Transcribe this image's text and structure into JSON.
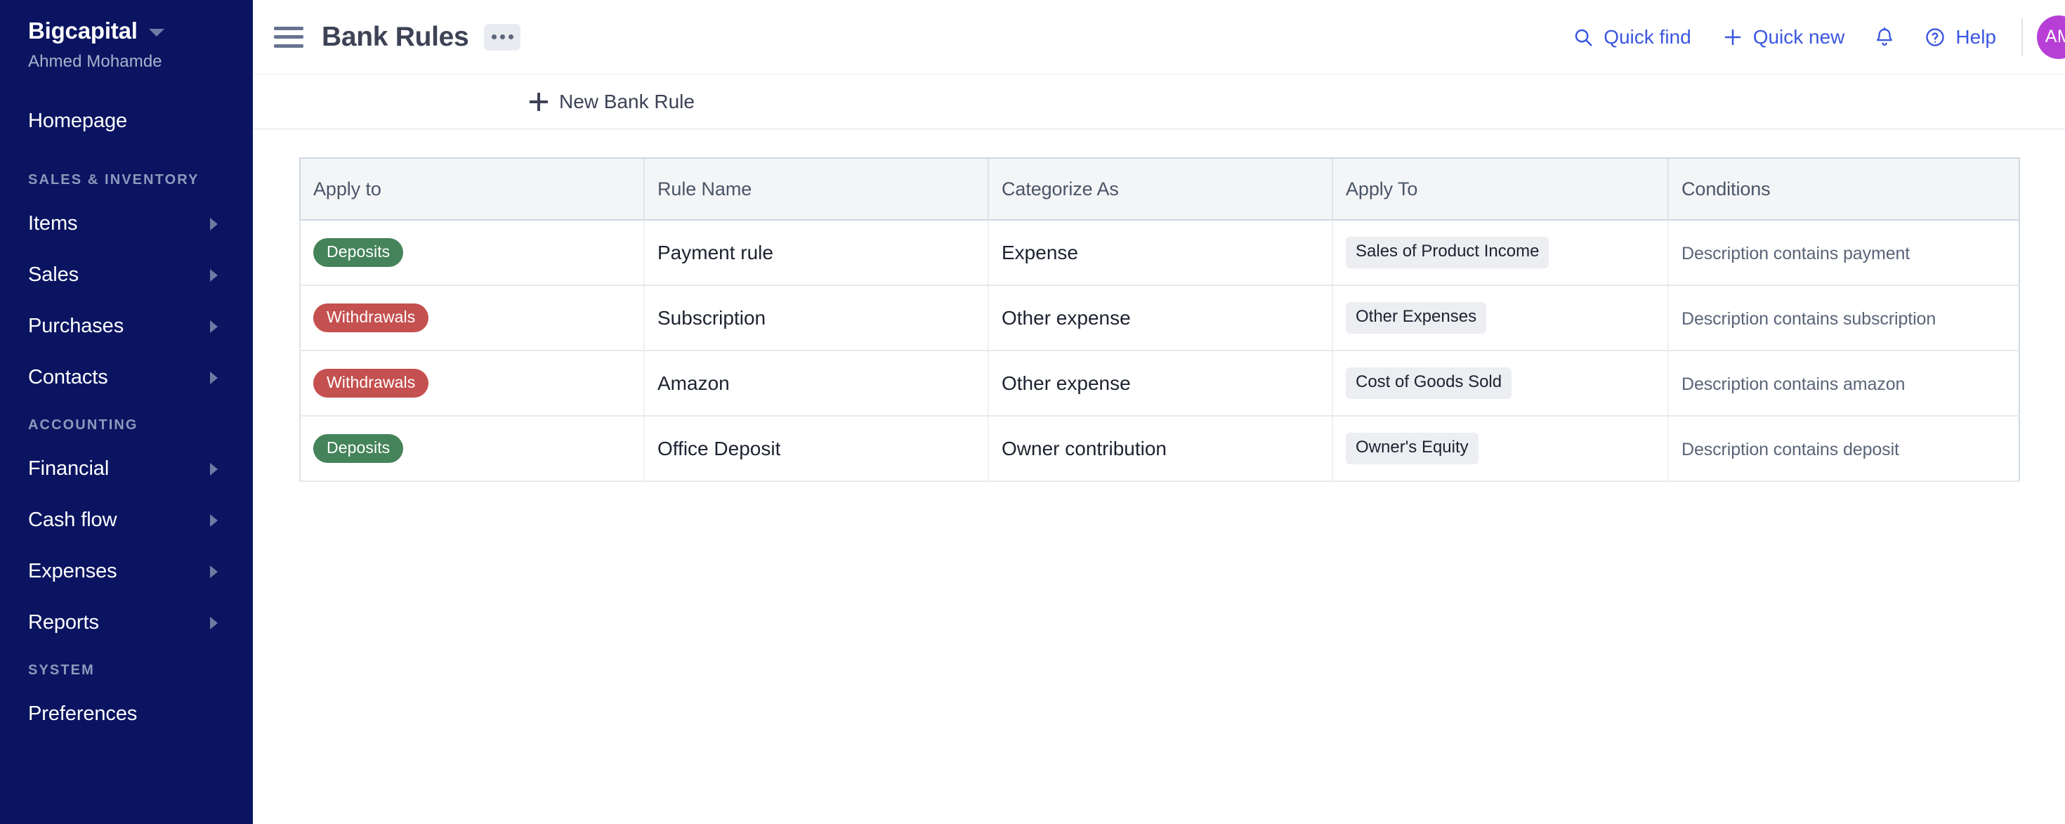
{
  "sidebar": {
    "brand": "Bigcapital",
    "user": "Ahmed Mohamde",
    "caret_icon": "chevron-down-icon",
    "items_top": [
      {
        "label": "Homepage",
        "has_chevron": false
      }
    ],
    "sections": [
      {
        "label": "SALES & INVENTORY",
        "items": [
          {
            "label": "Items",
            "has_chevron": true
          },
          {
            "label": "Sales",
            "has_chevron": true
          },
          {
            "label": "Purchases",
            "has_chevron": true
          },
          {
            "label": "Contacts",
            "has_chevron": true
          }
        ]
      },
      {
        "label": "ACCOUNTING",
        "items": [
          {
            "label": "Financial",
            "has_chevron": true
          },
          {
            "label": "Cash flow",
            "has_chevron": true
          },
          {
            "label": "Expenses",
            "has_chevron": true
          },
          {
            "label": "Reports",
            "has_chevron": true
          }
        ]
      },
      {
        "label": "SYSTEM",
        "items": [
          {
            "label": "Preferences",
            "has_chevron": false
          }
        ]
      }
    ]
  },
  "topbar": {
    "menu_icon": "hamburger-menu-icon",
    "title": "Bank Rules",
    "more_icon": "ellipsis-icon",
    "quick_find": "Quick find",
    "quick_find_icon": "search-icon",
    "quick_new": "Quick new",
    "quick_new_icon": "plus-icon",
    "notifications_icon": "bell-icon",
    "help": "Help",
    "help_icon": "question-circle-icon",
    "avatar_initials": "AM"
  },
  "subbar": {
    "new_rule_label": "New Bank Rule",
    "new_rule_icon": "plus-icon"
  },
  "table": {
    "columns": [
      "Apply to",
      "Rule Name",
      "Categorize As",
      "Apply To",
      "Conditions"
    ],
    "rows": [
      {
        "apply_to": "Deposits",
        "apply_to_type": "deposits",
        "rule_name": "Payment rule",
        "categorize_as": "Expense",
        "account": "Sales of Product Income",
        "conditions": "Description contains payment"
      },
      {
        "apply_to": "Withdrawals",
        "apply_to_type": "withdrawals",
        "rule_name": "Subscription",
        "categorize_as": "Other expense",
        "account": "Other Expenses",
        "conditions": "Description contains subscription"
      },
      {
        "apply_to": "Withdrawals",
        "apply_to_type": "withdrawals",
        "rule_name": "Amazon",
        "categorize_as": "Other expense",
        "account": "Cost of Goods Sold",
        "conditions": "Description contains amazon"
      },
      {
        "apply_to": "Deposits",
        "apply_to_type": "deposits",
        "rule_name": "Office Deposit",
        "categorize_as": "Owner contribution",
        "account": "Owner's Equity",
        "conditions": "Description contains deposit"
      }
    ]
  },
  "colors": {
    "sidebar_bg": "#0a1460",
    "accent_link": "#3b56e0",
    "badge_deposits": "#45835a",
    "badge_withdrawals": "#c4504f",
    "avatar_bg": "#b83fd6"
  }
}
